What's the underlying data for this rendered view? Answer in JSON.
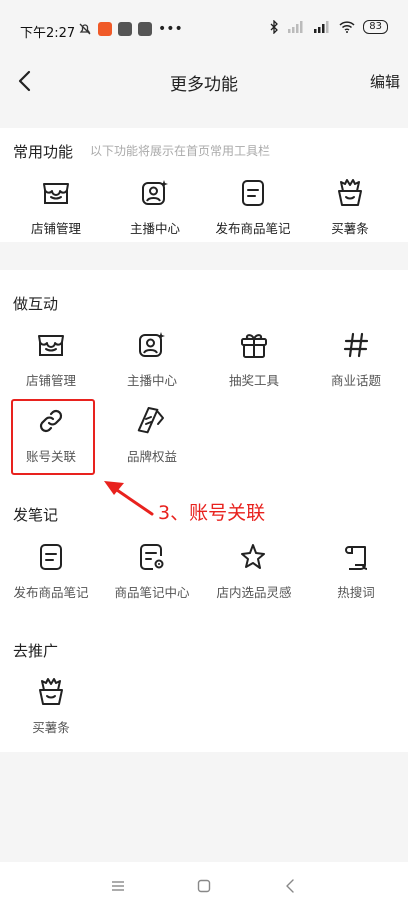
{
  "status": {
    "time": "下午2:27",
    "battery": "83"
  },
  "header": {
    "title": "更多功能",
    "edit": "编辑"
  },
  "common": {
    "title": "常用功能",
    "subtitle": "以下功能将展示在首页常用工具栏",
    "items": [
      {
        "label": "店铺管理",
        "icon": "shop-icon"
      },
      {
        "label": "主播中心",
        "icon": "anchor-icon"
      },
      {
        "label": "发布商品笔记",
        "icon": "note-icon"
      },
      {
        "label": "买薯条",
        "icon": "fries-icon"
      }
    ]
  },
  "interact": {
    "title": "做互动",
    "items": [
      {
        "label": "店铺管理",
        "icon": "shop-icon"
      },
      {
        "label": "主播中心",
        "icon": "anchor-icon"
      },
      {
        "label": "抽奖工具",
        "icon": "gift-icon"
      },
      {
        "label": "商业话题",
        "icon": "hashtag-icon"
      },
      {
        "label": "账号关联",
        "icon": "link-icon"
      },
      {
        "label": "品牌权益",
        "icon": "brand-icon"
      }
    ]
  },
  "notes": {
    "title": "发笔记",
    "items": [
      {
        "label": "发布商品笔记",
        "icon": "note-icon"
      },
      {
        "label": "商品笔记中心",
        "icon": "note-settings-icon"
      },
      {
        "label": "店内选品灵感",
        "icon": "star-icon"
      },
      {
        "label": "热搜词",
        "icon": "scroll-icon"
      }
    ]
  },
  "promote": {
    "title": "去推广",
    "items": [
      {
        "label": "买薯条",
        "icon": "fries-icon"
      }
    ]
  },
  "annotation": {
    "text": "3、账号关联",
    "color": "#e8221e"
  }
}
